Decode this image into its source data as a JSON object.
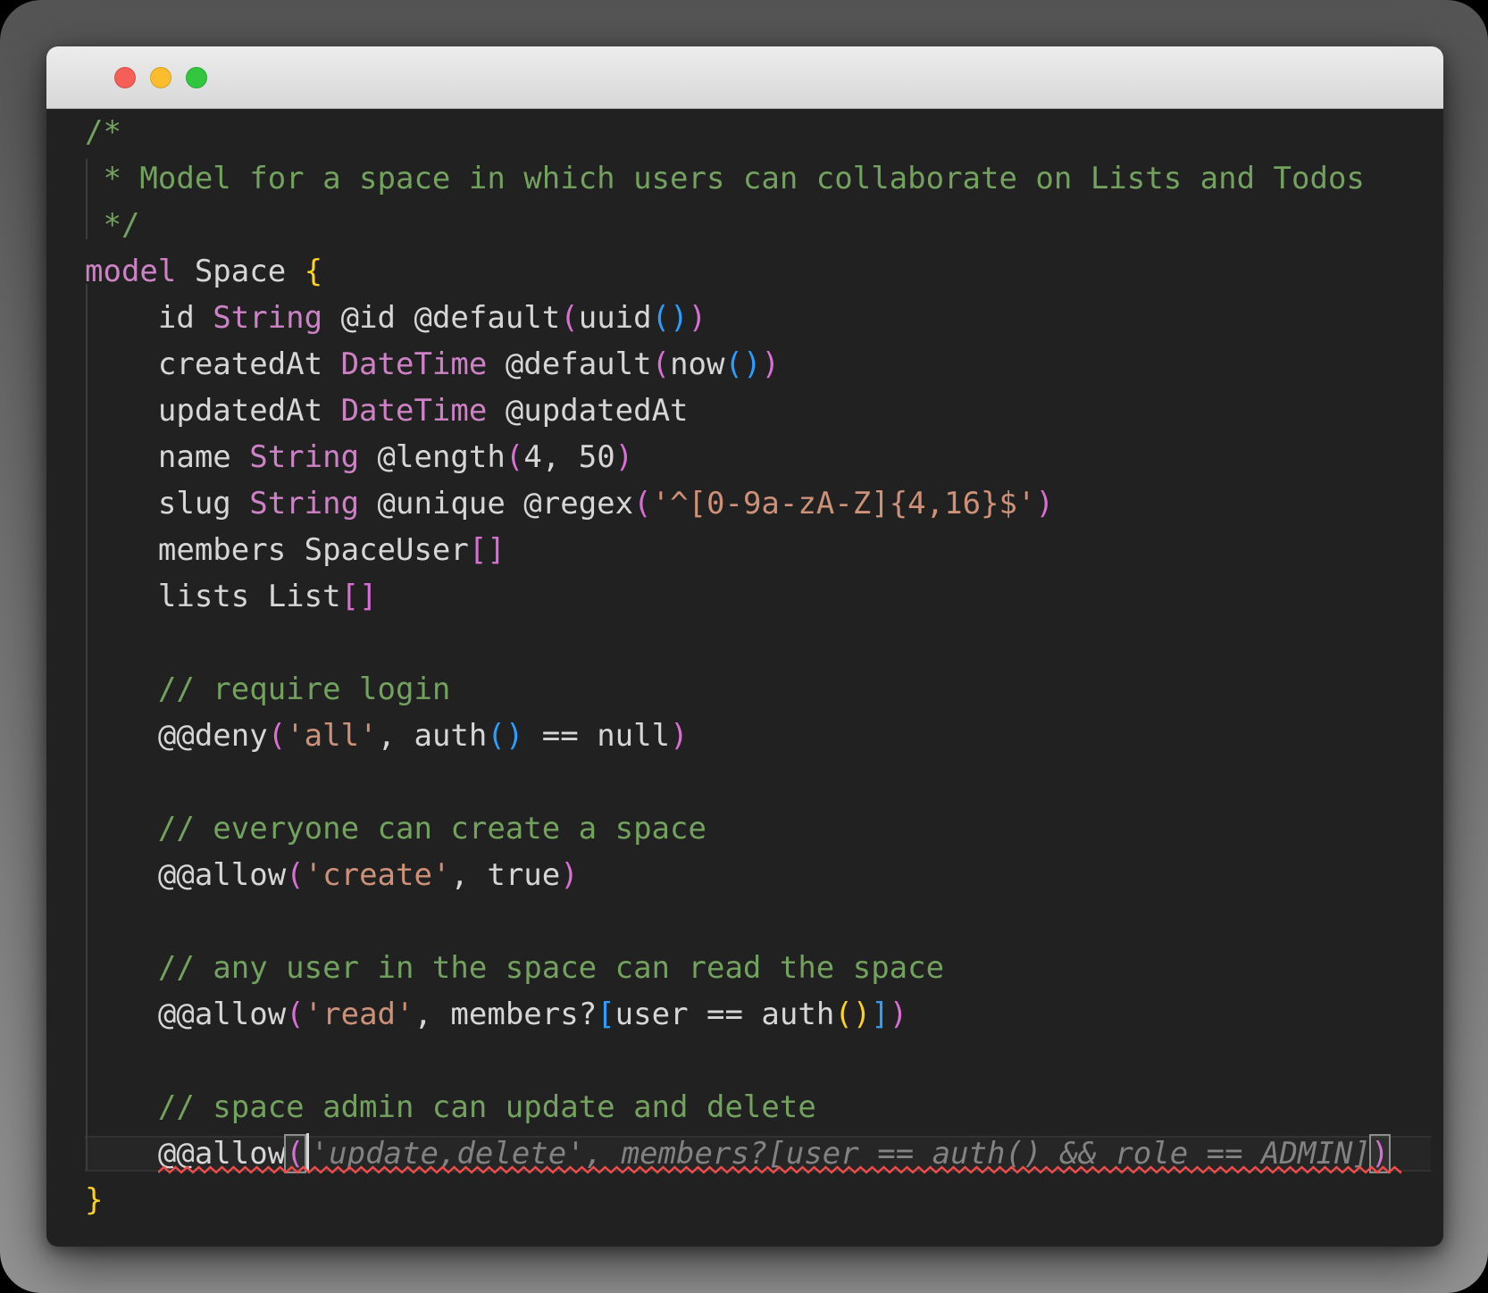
{
  "window": {
    "kind": "macos-code-editor-window",
    "title": "",
    "traffic_lights": [
      {
        "name": "close",
        "color": "#f45f58"
      },
      {
        "name": "minimize",
        "color": "#fbbd2e"
      },
      {
        "name": "maximize",
        "color": "#32c63f"
      }
    ]
  },
  "palette": {
    "editor_bg": "#212121",
    "titlebar_top": "#ececec",
    "titlebar_bottom": "#d8d8d8",
    "titlebar_border": "#aeaeae",
    "plain": "#d6d6d6",
    "comment": "#73a25f",
    "keyword": "#cd82c6",
    "type": "#cd82c6",
    "string": "#ce9178",
    "bracket1": "#ffd21c",
    "bracket2": "#d96fd4",
    "bracket3": "#2b9eff",
    "ghost": "#828282",
    "error": "#f24b4b",
    "guide": "#3c3c3c",
    "caret": "#d7d7d7",
    "match_border": "#8e8e8e",
    "current_line_border": "#323232",
    "close": "#f45f58",
    "minimize": "#fbbd2e",
    "maximize": "#32c63f"
  },
  "editor": {
    "language": "zmodel-schema",
    "ghost_suggestion": "'update,delete', members?[user == auth() && role == ADMIN]",
    "lines": [
      {
        "seg": [
          {
            "t": "/*",
            "s": "comment"
          }
        ]
      },
      {
        "seg": [
          {
            "t": " * Model for a space in which users can collaborate on Lists and Todos",
            "s": "comment"
          }
        ]
      },
      {
        "seg": [
          {
            "t": " */",
            "s": "comment"
          }
        ]
      },
      {
        "seg": [
          {
            "t": "model",
            "s": "keyword"
          },
          {
            "t": " Space ",
            "s": "plain"
          },
          {
            "t": "{",
            "s": "b1"
          }
        ]
      },
      {
        "seg": [
          {
            "t": "    id ",
            "s": "plain"
          },
          {
            "t": "String",
            "s": "type"
          },
          {
            "t": " @id @default",
            "s": "plain"
          },
          {
            "t": "(",
            "s": "b2"
          },
          {
            "t": "uuid",
            "s": "plain"
          },
          {
            "t": "()",
            "s": "b3"
          },
          {
            "t": ")",
            "s": "b2"
          }
        ]
      },
      {
        "seg": [
          {
            "t": "    createdAt ",
            "s": "plain"
          },
          {
            "t": "DateTime",
            "s": "type"
          },
          {
            "t": " @default",
            "s": "plain"
          },
          {
            "t": "(",
            "s": "b2"
          },
          {
            "t": "now",
            "s": "plain"
          },
          {
            "t": "()",
            "s": "b3"
          },
          {
            "t": ")",
            "s": "b2"
          }
        ]
      },
      {
        "seg": [
          {
            "t": "    updatedAt ",
            "s": "plain"
          },
          {
            "t": "DateTime",
            "s": "type"
          },
          {
            "t": " @updatedAt",
            "s": "plain"
          }
        ]
      },
      {
        "seg": [
          {
            "t": "    name ",
            "s": "plain"
          },
          {
            "t": "String",
            "s": "type"
          },
          {
            "t": " @length",
            "s": "plain"
          },
          {
            "t": "(",
            "s": "b2"
          },
          {
            "t": "4, 50",
            "s": "plain"
          },
          {
            "t": ")",
            "s": "b2"
          }
        ]
      },
      {
        "seg": [
          {
            "t": "    slug ",
            "s": "plain"
          },
          {
            "t": "String",
            "s": "type"
          },
          {
            "t": " @unique @regex",
            "s": "plain"
          },
          {
            "t": "(",
            "s": "b2"
          },
          {
            "t": "'^[0-9a-zA-Z]{4,16}$'",
            "s": "string"
          },
          {
            "t": ")",
            "s": "b2"
          }
        ]
      },
      {
        "seg": [
          {
            "t": "    members SpaceUser",
            "s": "plain"
          },
          {
            "t": "[]",
            "s": "b2"
          }
        ]
      },
      {
        "seg": [
          {
            "t": "    lists List",
            "s": "plain"
          },
          {
            "t": "[]",
            "s": "b2"
          }
        ]
      },
      {
        "seg": []
      },
      {
        "seg": [
          {
            "t": "    // require login",
            "s": "comment"
          }
        ]
      },
      {
        "seg": [
          {
            "t": "    @@deny",
            "s": "plain"
          },
          {
            "t": "(",
            "s": "b2"
          },
          {
            "t": "'all'",
            "s": "string"
          },
          {
            "t": ", auth",
            "s": "plain"
          },
          {
            "t": "()",
            "s": "b3"
          },
          {
            "t": " == null",
            "s": "plain"
          },
          {
            "t": ")",
            "s": "b2"
          }
        ]
      },
      {
        "seg": []
      },
      {
        "seg": [
          {
            "t": "    // everyone can create a space",
            "s": "comment"
          }
        ]
      },
      {
        "seg": [
          {
            "t": "    @@allow",
            "s": "plain"
          },
          {
            "t": "(",
            "s": "b2"
          },
          {
            "t": "'create'",
            "s": "string"
          },
          {
            "t": ", true",
            "s": "plain"
          },
          {
            "t": ")",
            "s": "b2"
          }
        ]
      },
      {
        "seg": []
      },
      {
        "seg": [
          {
            "t": "    // any user in the space can read the space",
            "s": "comment"
          }
        ]
      },
      {
        "seg": [
          {
            "t": "    @@allow",
            "s": "plain"
          },
          {
            "t": "(",
            "s": "b2"
          },
          {
            "t": "'read'",
            "s": "string"
          },
          {
            "t": ", members?",
            "s": "plain"
          },
          {
            "t": "[",
            "s": "b3"
          },
          {
            "t": "user == auth",
            "s": "plain"
          },
          {
            "t": "()",
            "s": "b1"
          },
          {
            "t": "]",
            "s": "b3"
          },
          {
            "t": ")",
            "s": "b2"
          }
        ]
      },
      {
        "seg": []
      },
      {
        "seg": [
          {
            "t": "    // space admin can update and delete",
            "s": "comment"
          }
        ]
      },
      {
        "current": true,
        "squiggle": {
          "from_col": 4,
          "cols": 68
        },
        "seg": [
          {
            "t": "    @@allow",
            "s": "plain"
          },
          {
            "t": "(",
            "s": "b2",
            "match": true
          },
          {
            "caret": true
          },
          {
            "t": "'update,delete', members?[user == auth() && role == ADMIN]",
            "s": "ghost"
          },
          {
            "t": ")",
            "s": "b2",
            "match": true
          }
        ]
      },
      {
        "seg": [
          {
            "t": "}",
            "s": "b1"
          }
        ]
      }
    ]
  }
}
